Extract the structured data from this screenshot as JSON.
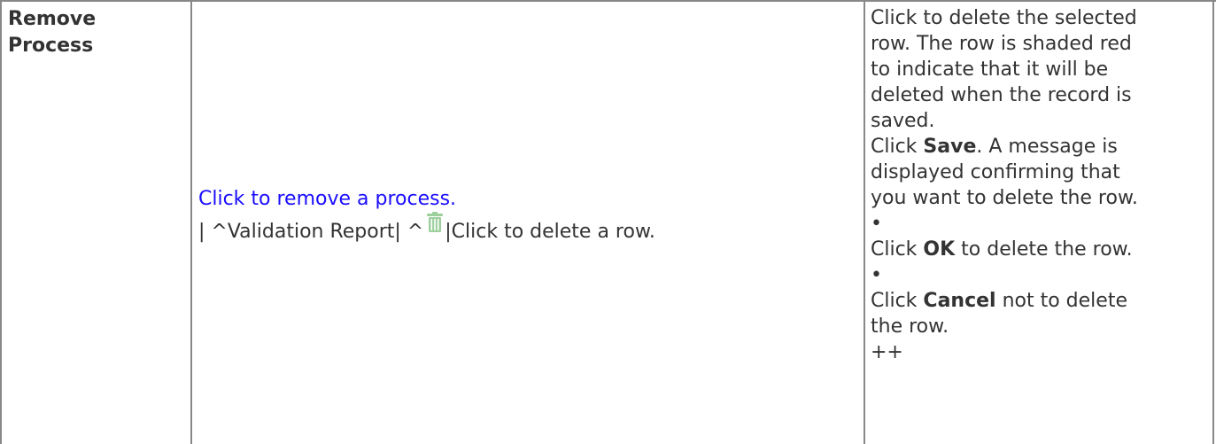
{
  "table": {
    "col1": {
      "line1": "Remove",
      "line2": "Process"
    },
    "col2": {
      "link": "Click to remove a process.",
      "row_prefix": "| ^Validation Report| ^",
      "row_suffix": "|Click to delete a row.",
      "icon": "trash-icon"
    },
    "col3": {
      "l1": "Click to delete the selected",
      "l2": "row. The row is shaded red",
      "l3": "to indicate that it will be",
      "l4": "deleted when the record is",
      "l5": "saved.",
      "l6_pre": "Click ",
      "l6_bold": "Save",
      "l6_post": ". A message is",
      "l7": "displayed confirming that",
      "l8": "you want to delete the row.",
      "bullet1": "•",
      "l9_pre": "Click ",
      "l9_bold": "OK",
      "l9_post": " to delete the row.",
      "bullet2": "•",
      "l10_pre": "Click ",
      "l10_bold": "Cancel",
      "l10_post": " not to delete",
      "l11": "the row.",
      "l12": "++"
    }
  },
  "colors": {
    "link": "#1a0dff",
    "text": "#333333",
    "border": "#888888",
    "trash": "#9ccf9c"
  }
}
